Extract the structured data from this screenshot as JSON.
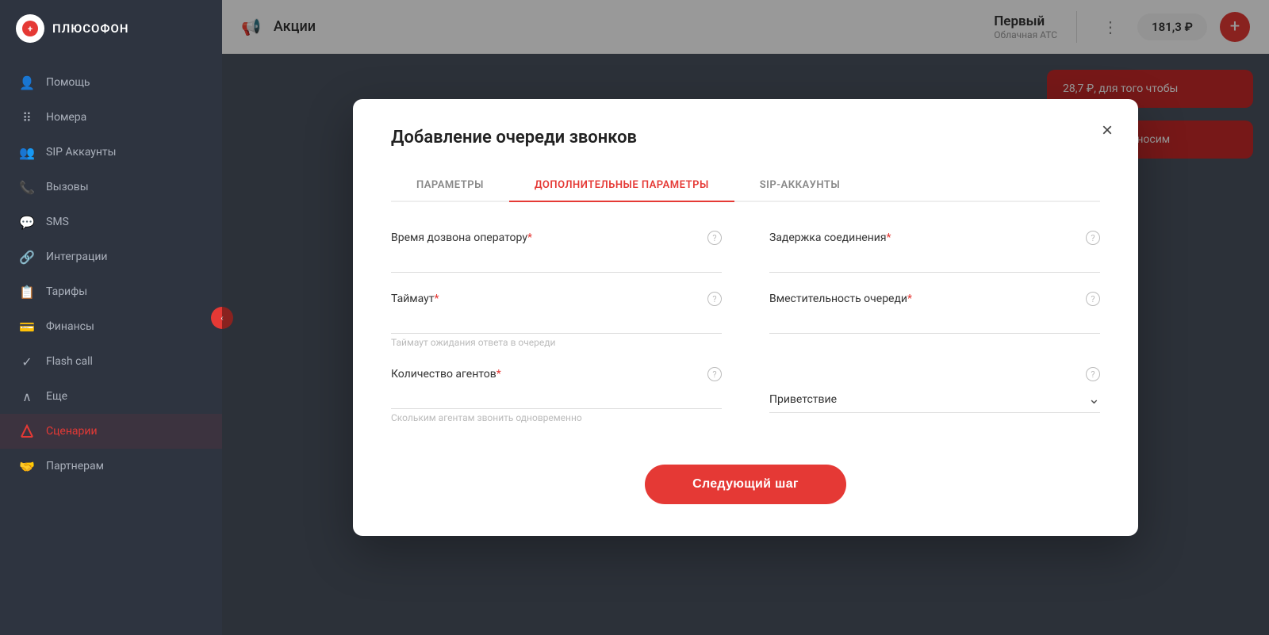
{
  "sidebar": {
    "brand": "ПЛЮСОФОН",
    "items": [
      {
        "id": "help",
        "label": "Помощь",
        "icon": "👤",
        "active": false
      },
      {
        "id": "numbers",
        "label": "Номера",
        "icon": "⠿",
        "active": false
      },
      {
        "id": "sip",
        "label": "SIP Аккаунты",
        "icon": "👥",
        "active": false
      },
      {
        "id": "calls",
        "label": "Вызовы",
        "icon": "📞",
        "active": false
      },
      {
        "id": "sms",
        "label": "SMS",
        "icon": "💬",
        "active": false
      },
      {
        "id": "integrations",
        "label": "Интеграции",
        "icon": "🔗",
        "active": false
      },
      {
        "id": "tariffs",
        "label": "Тарифы",
        "icon": "📋",
        "active": false
      },
      {
        "id": "finances",
        "label": "Финансы",
        "icon": "💳",
        "active": false
      },
      {
        "id": "flash-call",
        "label": "Flash call",
        "icon": "✓",
        "active": false
      },
      {
        "id": "more",
        "label": "Еще",
        "icon": "∧",
        "active": false
      },
      {
        "id": "scenarios",
        "label": "Сценарии",
        "icon": "↗",
        "active": true
      },
      {
        "id": "partners",
        "label": "Партнерам",
        "icon": "🤝",
        "active": false
      }
    ]
  },
  "topbar": {
    "promo_icon": "📢",
    "promo_label": "Акции",
    "promo_sub": "",
    "company_name": "Первый",
    "company_type": "Облачная АТС",
    "balance": "181,3 ₽",
    "add_btn_label": "+"
  },
  "modal": {
    "title": "Добавление очереди звонков",
    "close_label": "×",
    "tabs": [
      {
        "id": "params",
        "label": "ПАРАМЕТРЫ",
        "active": false
      },
      {
        "id": "extra",
        "label": "ДОПОЛНИТЕЛЬНЫЕ ПАРАМЕТРЫ",
        "active": true
      },
      {
        "id": "sip-accounts",
        "label": "SIP-АККАУНТЫ",
        "active": false
      }
    ],
    "fields": {
      "operator_dial_time": {
        "label": "Время дозвона оператору",
        "required": true,
        "value": "",
        "placeholder": ""
      },
      "connection_delay": {
        "label": "Задержка соединения",
        "required": true,
        "value": "",
        "placeholder": ""
      },
      "timeout": {
        "label": "Таймаут",
        "required": true,
        "value": "",
        "placeholder": "",
        "hint": "Таймаут ожидания ответа в очереди"
      },
      "queue_capacity": {
        "label": "Вместительность очереди",
        "required": true,
        "value": "",
        "placeholder": ""
      },
      "agent_count": {
        "label": "Количество агентов",
        "required": true,
        "value": "",
        "placeholder": "",
        "hint": "Скольким агентам звонить одновременно"
      },
      "greeting": {
        "label": "Приветствие",
        "required": false,
        "value": "Приветствие",
        "is_select": true
      }
    },
    "next_btn_label": "Следующий шаг"
  }
}
